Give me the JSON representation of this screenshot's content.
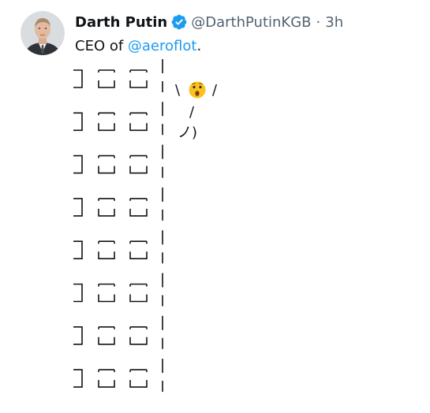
{
  "author": {
    "display_name": "Darth Putin",
    "handle": "@DarthPutinKGB",
    "separator": "·",
    "time": "3h",
    "verified_color": "#1d9bf0"
  },
  "tweet": {
    "text_prefix": "CEO of ",
    "mention": "@aeroflot",
    "text_suffix": ".",
    "art": {
      "row_count": 8,
      "figure": {
        "head_left": "\\",
        "emoji": "😲",
        "head_right": "/",
        "arm": "/",
        "legs": "ノ)"
      }
    }
  }
}
